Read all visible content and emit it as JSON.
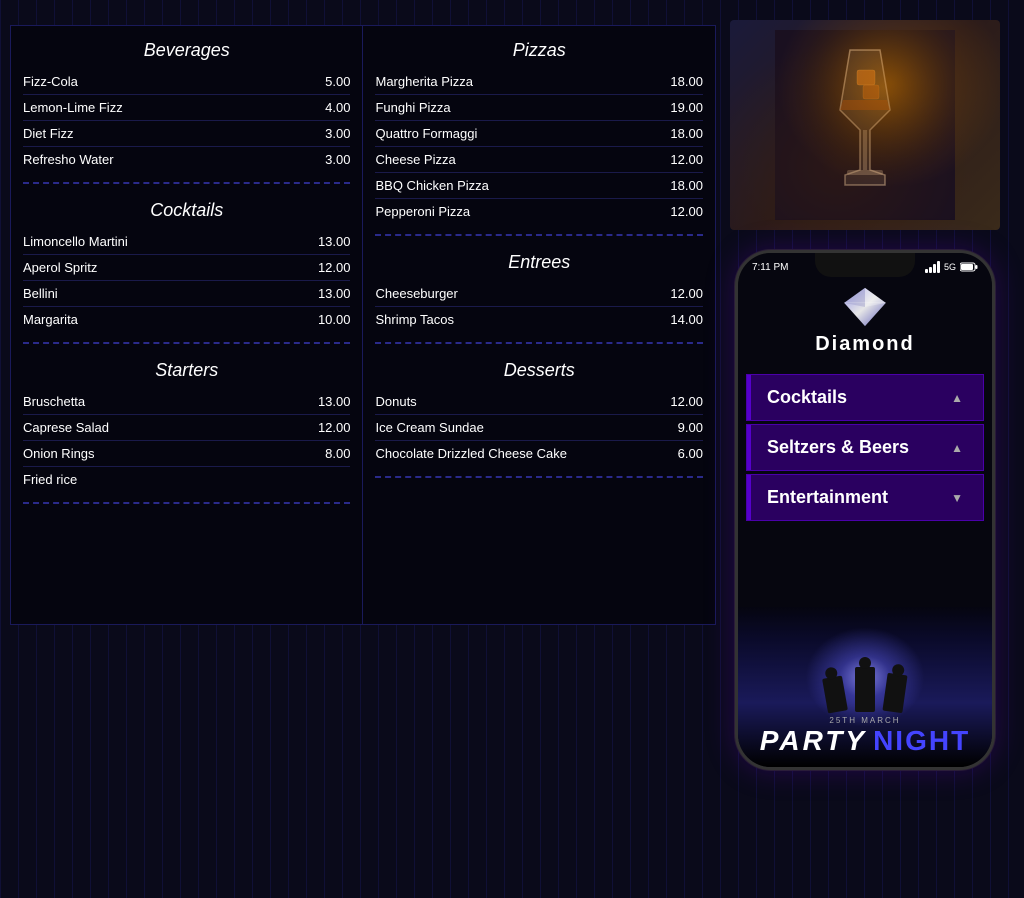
{
  "menu": {
    "left_column": {
      "beverages": {
        "title": "Beverages",
        "items": [
          {
            "name": "Fizz-Cola",
            "price": "5.00"
          },
          {
            "name": "Lemon-Lime Fizz",
            "price": "4.00"
          },
          {
            "name": "Diet Fizz",
            "price": "3.00"
          },
          {
            "name": "Refresho Water",
            "price": "3.00"
          }
        ]
      },
      "cocktails": {
        "title": "Cocktails",
        "items": [
          {
            "name": "Limoncello Martini",
            "price": "13.00"
          },
          {
            "name": "Aperol Spritz",
            "price": "12.00"
          },
          {
            "name": "Bellini",
            "price": "13.00"
          },
          {
            "name": "Margarita",
            "price": "10.00"
          }
        ]
      },
      "starters": {
        "title": "Starters",
        "items": [
          {
            "name": "Bruschetta",
            "price": "13.00"
          },
          {
            "name": "Caprese Salad",
            "price": "12.00"
          },
          {
            "name": "Onion Rings",
            "price": "8.00"
          },
          {
            "name": "Fried rice",
            "price": ""
          }
        ]
      }
    },
    "right_column": {
      "pizzas": {
        "title": "Pizzas",
        "items": [
          {
            "name": "Margherita Pizza",
            "price": "18.00"
          },
          {
            "name": "Funghi Pizza",
            "price": "19.00"
          },
          {
            "name": "Quattro Formaggi",
            "price": "18.00"
          },
          {
            "name": "Cheese Pizza",
            "price": "12.00"
          },
          {
            "name": "BBQ Chicken Pizza",
            "price": "18.00"
          },
          {
            "name": "Pepperoni Pizza",
            "price": "12.00"
          }
        ]
      },
      "entrees": {
        "title": "Entrees",
        "items": [
          {
            "name": "Cheeseburger",
            "price": "12.00"
          },
          {
            "name": "Shrimp Tacos",
            "price": "14.00"
          }
        ]
      },
      "desserts": {
        "title": "Desserts",
        "items": [
          {
            "name": "Donuts",
            "price": "12.00"
          },
          {
            "name": "Ice Cream Sundae",
            "price": "9.00"
          },
          {
            "name": "Chocolate Drizzled Cheese Cake",
            "price": "6.00"
          }
        ]
      }
    }
  },
  "phone": {
    "status_time": "7:11 PM",
    "status_signal": "5G",
    "brand_name": "Diamond",
    "buttons": [
      {
        "label": "Cocktails",
        "arrow": "▲"
      },
      {
        "label": "Seltzers & Beers",
        "arrow": "▲"
      },
      {
        "label": "Entertainment",
        "arrow": "▼"
      }
    ],
    "party": {
      "date": "25TH MARCH",
      "title": "PARTY",
      "subtitle": "NIGHT"
    }
  }
}
